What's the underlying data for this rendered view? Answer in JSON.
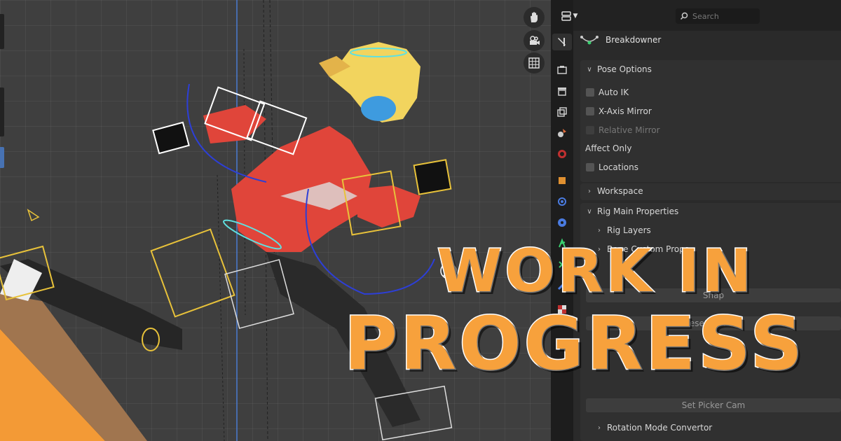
{
  "overlay": {
    "line1": "WORK IN",
    "line2": "PROGRESS",
    "color": "#f7a13c"
  },
  "viewport": {
    "nav_icons": [
      "hand-icon",
      "camera-icon",
      "grid-icon"
    ]
  },
  "properties": {
    "search": {
      "placeholder": "Search"
    },
    "addon_title": "Breakdowner",
    "pose_options": {
      "label": "Pose Options",
      "expanded": true,
      "auto_ik": "Auto IK",
      "x_axis_mirror": "X-Axis Mirror",
      "relative_mirror": "Relative Mirror",
      "affect_only": "Affect Only",
      "locations": "Locations"
    },
    "workspace": {
      "label": "Workspace",
      "expanded": false
    },
    "rig_main": {
      "label": "Rig Main Properties",
      "expanded": true,
      "rig_layers": "Rig Layers",
      "bone_custom_props": "Bone Custom Props",
      "snap_button": "Snap",
      "reset_all_pose_button": "Reset All Pose",
      "set_picker_cam_button": "Set Picker Cam",
      "rotation_mode_convertor": "Rotation Mode Convertor"
    },
    "tab_icons": [
      "tool-icon",
      "render-icon",
      "output-icon",
      "view-layer-icon",
      "scene-icon",
      "world-icon",
      "object-icon",
      "modifier-icon",
      "particles-icon",
      "physics-icon",
      "constraints-icon",
      "data-icon",
      "bone-icon",
      "texture-icon"
    ]
  }
}
